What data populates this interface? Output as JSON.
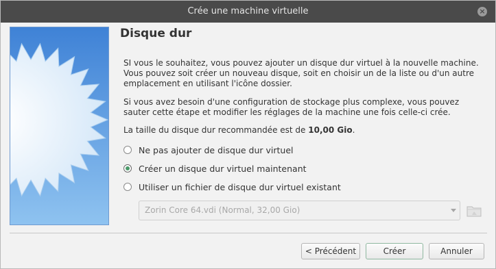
{
  "window": {
    "title": "Crée une machine virtuelle"
  },
  "page": {
    "title": "Disque dur",
    "intro": "SI vous le souhaitez, vous pouvez ajouter un disque dur virtuel à la nouvelle machine. Vous pouvez soit créer un nouveau disque, soit en choisir un de la liste ou d'un autre emplacement en utilisant l'icône dossier.",
    "advanced": "Si vous avez besoin d'une configuration de stockage plus complexe, vous pouvez sauter cette étape et modifier les réglages de la machine une fois celle-ci crée.",
    "recommended_prefix": "La taille du disque dur recommandée est de ",
    "recommended_size": "10,00 Gio",
    "recommended_suffix": "."
  },
  "options": {
    "no_disk": "Ne pas ajouter de disque dur virtuel",
    "create_new": "Créer un disque dur virtuel maintenant",
    "use_existing": "Utiliser un fichier de disque dur virtuel existant",
    "selected": "create_new"
  },
  "existing_disk": {
    "value": "Zorin Core 64.vdi (Normal, 32,00 Gio)"
  },
  "icons": {
    "close": "close-icon",
    "folder": "folder-icon",
    "dropdown": "chevron-down-icon",
    "wizard": "starburst-illustration"
  },
  "buttons": {
    "back": "< Précédent",
    "create": "Créer",
    "cancel": "Annuler"
  },
  "colors": {
    "titlebar": "#4a4a4a",
    "radio_selected": "#4a9a6a",
    "image_sky": "#3f82d6"
  }
}
